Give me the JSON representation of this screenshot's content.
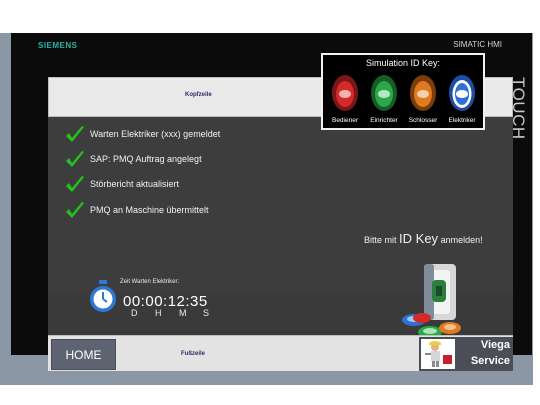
{
  "device": {
    "brand": "SIEMENS",
    "model": "SIMATIC HMI",
    "touch_label": "TOUCH"
  },
  "screen": {
    "header_label": "Kopfzeile",
    "footer_label": "Fußzeile",
    "steps": [
      {
        "text": "Warten Elektriker (xxx) gemeldet",
        "icon": "check-icon",
        "done": true
      },
      {
        "text": "SAP: PMQ Auftrag angelegt",
        "icon": "check-icon",
        "done": true
      },
      {
        "text": "Störbericht aktualisiert",
        "icon": "check-icon",
        "done": true
      },
      {
        "text": "PMQ an Maschine übermittelt",
        "icon": "check-icon",
        "done": true
      }
    ],
    "timer": {
      "caption": "Zeit Warten Elektriker:",
      "value": "00:00:12:35",
      "units": [
        "D",
        "H",
        "M",
        "S"
      ],
      "icon": "stopwatch-icon"
    },
    "login_prompt": {
      "prefix": "Bitte mit",
      "key": "ID Key",
      "suffix": "anmelden!"
    },
    "home_button": "HOME",
    "service_button": {
      "line1": "Viega",
      "line2": "Service",
      "icon": "service-worker-icon"
    }
  },
  "simulation": {
    "title": "Simulation ID Key:",
    "keys": [
      {
        "label": "Bediener",
        "color": "#d42a2a",
        "icon": "id-key-red-icon"
      },
      {
        "label": "Einrichter",
        "color": "#2aa84a",
        "icon": "id-key-green-icon"
      },
      {
        "label": "Schlosser",
        "color": "#e07a1f",
        "icon": "id-key-orange-icon"
      },
      {
        "label": "Elektriker",
        "color": "#2f6fd6",
        "icon": "id-key-blue-icon"
      }
    ]
  },
  "colors": {
    "screen_background": "#3d3d3d",
    "check": "#22c21f",
    "home_button": "#5d6370",
    "brand": "#2ab3a7"
  }
}
